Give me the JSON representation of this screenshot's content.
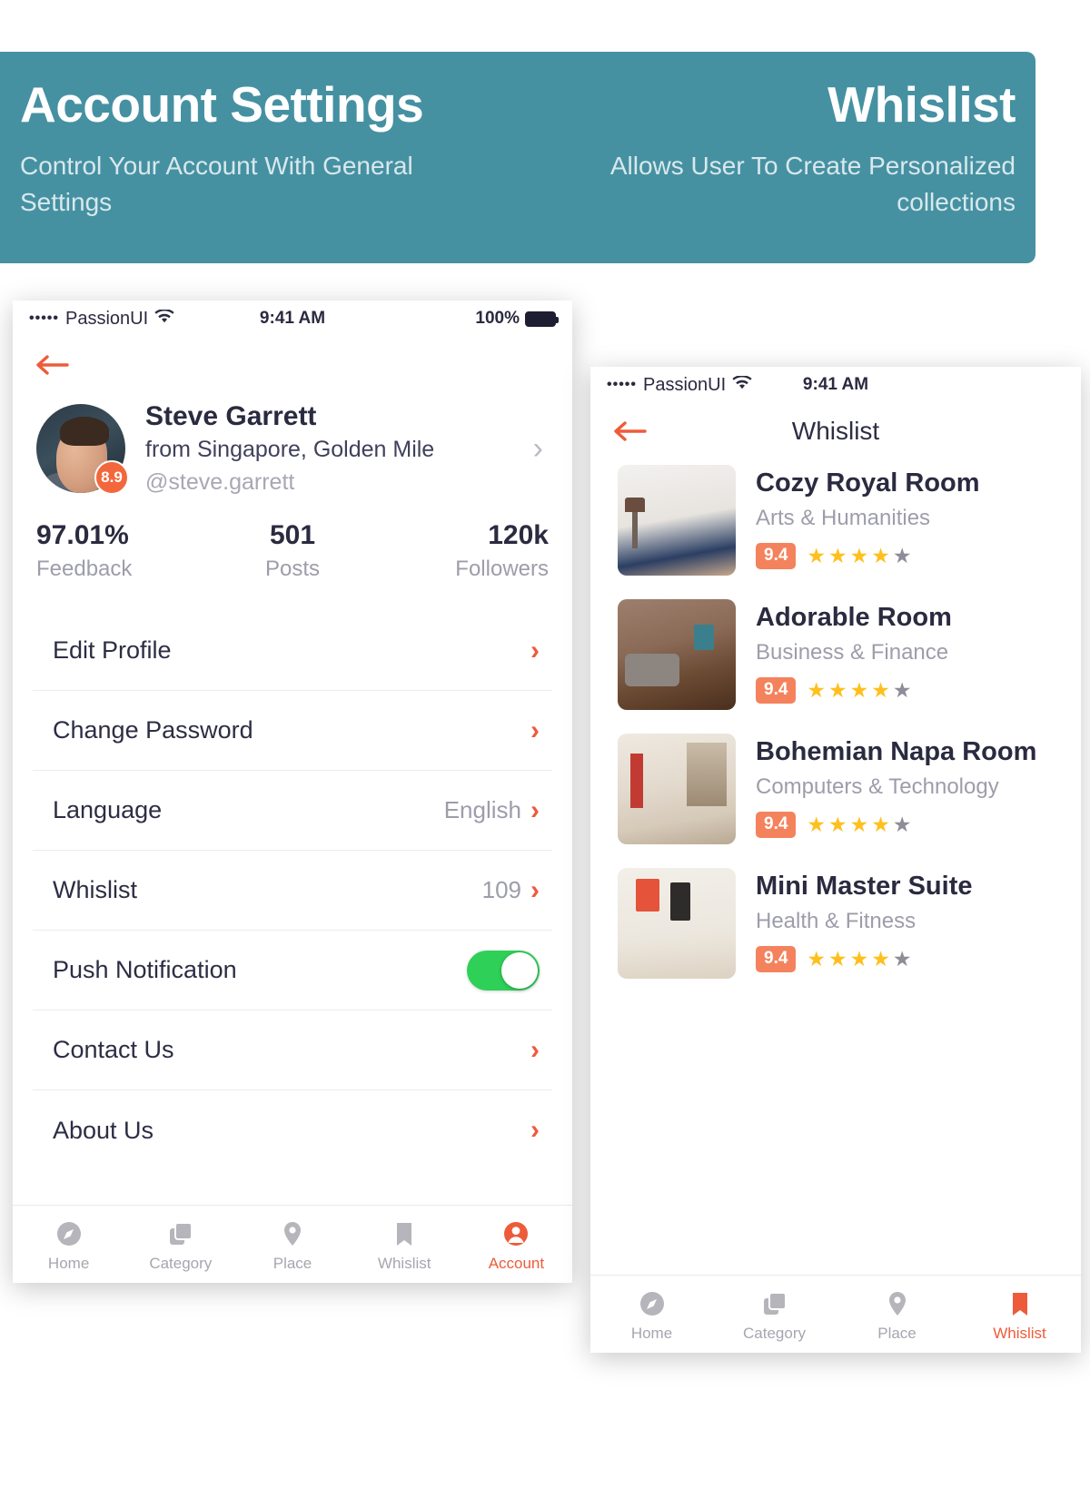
{
  "banner": {
    "left": {
      "title": "Account Settings",
      "subtitle": "Control Your Account With General Settings"
    },
    "right": {
      "title": "Whislist",
      "subtitle": "Allows User To Create Personalized collections"
    },
    "bg_color": "#4591a2"
  },
  "accent": {
    "orange": "#ee5b3a",
    "badge_orange": "#f2683c",
    "green": "#2fd058",
    "star_gold": "#ffc01e",
    "star_gray": "#8d8d98"
  },
  "phone_left": {
    "status": {
      "dots": "•••••",
      "carrier": "PassionUI",
      "wifi": "wifi-icon",
      "time": "9:41 AM",
      "battery": "100%"
    },
    "nav": {
      "back": "back-arrow-icon"
    },
    "profile": {
      "name": "Steve Garrett",
      "location": "from Singapore, Golden Mile",
      "handle": "@steve.garrett",
      "score": "8.9",
      "chevron": "›"
    },
    "stats": [
      {
        "value": "97.01%",
        "label": "Feedback"
      },
      {
        "value": "501",
        "label": "Posts"
      },
      {
        "value": "120k",
        "label": "Followers"
      }
    ],
    "settings": [
      {
        "label": "Edit Profile",
        "value": "",
        "type": "chevron"
      },
      {
        "label": "Change Password",
        "value": "",
        "type": "chevron"
      },
      {
        "label": "Language",
        "value": "English",
        "type": "chevron"
      },
      {
        "label": "Whislist",
        "value": "109",
        "type": "chevron"
      },
      {
        "label": "Push Notification",
        "value": "",
        "type": "toggle",
        "toggle_on": true
      },
      {
        "label": "Contact Us",
        "value": "",
        "type": "chevron"
      },
      {
        "label": "About Us",
        "value": "",
        "type": "chevron"
      }
    ],
    "tabs": [
      {
        "label": "Home",
        "icon": "compass-icon",
        "active": false
      },
      {
        "label": "Category",
        "icon": "layers-icon",
        "active": false
      },
      {
        "label": "Place",
        "icon": "pin-icon",
        "active": false
      },
      {
        "label": "Whislist",
        "icon": "bookmark-icon",
        "active": false
      },
      {
        "label": "Account",
        "icon": "person-icon",
        "active": true
      }
    ]
  },
  "phone_right": {
    "status": {
      "dots": "•••••",
      "carrier": "PassionUI",
      "wifi": "wifi-icon",
      "time": "9:41 AM"
    },
    "nav": {
      "back": "back-arrow-icon",
      "title": "Whislist"
    },
    "cards": [
      {
        "title": "Cozy Royal Room",
        "category": "Arts & Humanities",
        "rating": "9.4",
        "stars_on": 4,
        "stars_total": 5
      },
      {
        "title": "Adorable Room",
        "category": "Business & Finance",
        "rating": "9.4",
        "stars_on": 4,
        "stars_total": 5
      },
      {
        "title": "Bohemian Napa Room",
        "category": "Computers & Technology",
        "rating": "9.4",
        "stars_on": 4,
        "stars_total": 5
      },
      {
        "title": "Mini Master Suite",
        "category": "Health & Fitness",
        "rating": "9.4",
        "stars_on": 4,
        "stars_total": 5
      }
    ],
    "tabs": [
      {
        "label": "Home",
        "icon": "compass-icon",
        "active": false
      },
      {
        "label": "Category",
        "icon": "layers-icon",
        "active": false
      },
      {
        "label": "Place",
        "icon": "pin-icon",
        "active": false
      },
      {
        "label": "Whislist",
        "icon": "bookmark-icon",
        "active": true
      }
    ]
  }
}
